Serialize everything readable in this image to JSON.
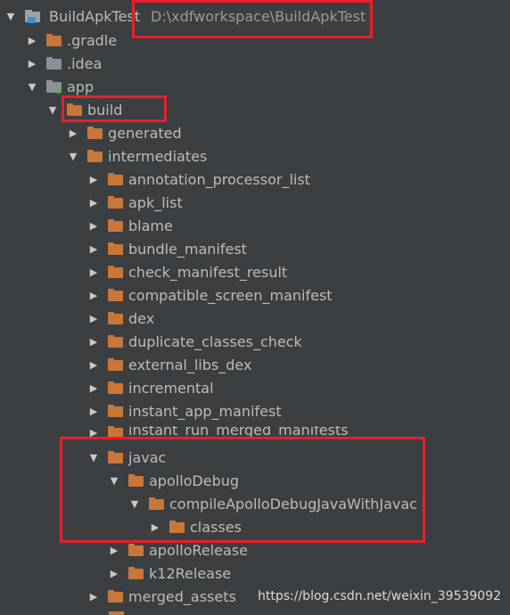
{
  "project": {
    "name": "BuildApkTest",
    "path": "D:\\xdfworkspace\\BuildApkTest"
  },
  "items": {
    "gradle": ".gradle",
    "idea": ".idea",
    "app": "app",
    "build": "build",
    "generated": "generated",
    "intermediates": "intermediates",
    "annotation_processor_list": "annotation_processor_list",
    "apk_list": "apk_list",
    "blame": "blame",
    "bundle_manifest": "bundle_manifest",
    "check_manifest_result": "check_manifest_result",
    "compatible_screen_manifest": "compatible_screen_manifest",
    "dex": "dex",
    "duplicate_classes_check": "duplicate_classes_check",
    "external_libs_dex": "external_libs_dex",
    "incremental": "incremental",
    "instant_app_manifest": "instant_app_manifest",
    "instant_run_merged_manifests": "instant_run_merged_manifests",
    "javac": "javac",
    "apolloDebug": "apolloDebug",
    "compileApolloDebugJavaWithJavac": "compileApolloDebugJavaWithJavac",
    "classes": "classes",
    "apolloRelease": "apolloRelease",
    "k12Release": "k12Release",
    "merged_assets": "merged_assets"
  },
  "watermark": "https://blog.csdn.net/weixin_39539092",
  "colors": {
    "background": "#3c3f41",
    "folder": "#c97639",
    "highlight_box": "#e8202a",
    "text": "#bbbbbb"
  },
  "icons": {
    "expanded": "triangle-down",
    "collapsed": "triangle-right",
    "folder": "folder-icon",
    "module": "module-folder-icon",
    "project": "project-icon"
  }
}
